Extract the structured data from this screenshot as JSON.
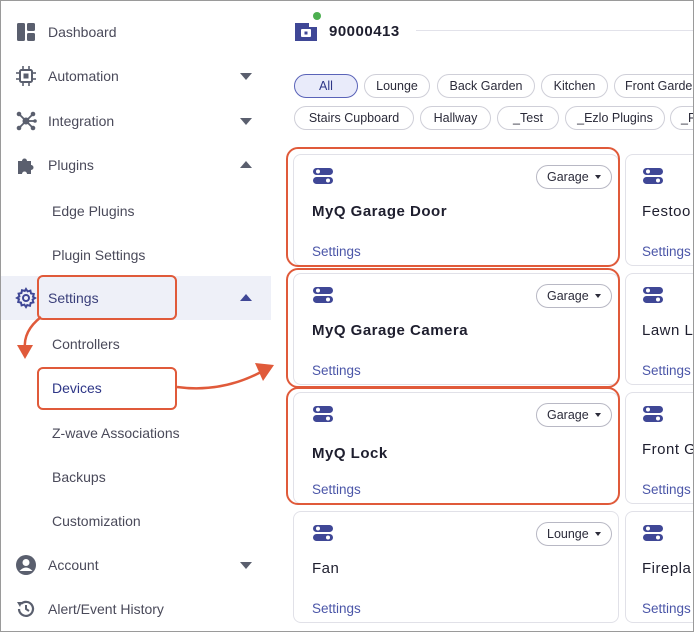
{
  "sidebar": {
    "items": [
      {
        "label": "Dashboard",
        "icon": "dashboard-icon"
      },
      {
        "label": "Automation",
        "icon": "automation-icon"
      },
      {
        "label": "Integration",
        "icon": "integration-icon"
      },
      {
        "label": "Plugins",
        "icon": "puzzle-icon"
      },
      {
        "label": "Edge Plugins"
      },
      {
        "label": "Plugin Settings"
      },
      {
        "label": "Settings",
        "icon": "gear-icon"
      },
      {
        "label": "Controllers"
      },
      {
        "label": "Devices"
      },
      {
        "label": "Z-wave Associations"
      },
      {
        "label": "Backups"
      },
      {
        "label": "Customization"
      },
      {
        "label": "Account",
        "icon": "user-icon"
      },
      {
        "label": "Alert/Event History",
        "icon": "history-icon"
      }
    ]
  },
  "header": {
    "controller_id": "90000413",
    "icon": "controller-icon",
    "status_color": "#4caf50"
  },
  "filters": [
    "All",
    "Lounge",
    "Back Garden",
    "Kitchen",
    "Front Garde",
    "Stairs Cupboard",
    "Hallway",
    "_Test",
    "_Ezlo Plugins",
    "_P"
  ],
  "devices": [
    {
      "name": "MyQ Garage Door",
      "room": "Garage",
      "settings": "Settings"
    },
    {
      "name": "MyQ Garage Camera",
      "room": "Garage",
      "settings": "Settings"
    },
    {
      "name": "MyQ Lock",
      "room": "Garage",
      "settings": "Settings"
    },
    {
      "name": "Fan",
      "room": "Lounge",
      "settings": "Settings"
    }
  ],
  "devices_right": [
    {
      "name": "Festoo",
      "settings": "Settings"
    },
    {
      "name": "Lawn L",
      "settings": "Settings"
    },
    {
      "name": "Front G",
      "settings": "Settings"
    },
    {
      "name": "Firepla",
      "settings": "Settings"
    }
  ],
  "colors": {
    "accent": "#4b56a8",
    "highlight": "#e05a3a",
    "icon": "#3f4796"
  }
}
